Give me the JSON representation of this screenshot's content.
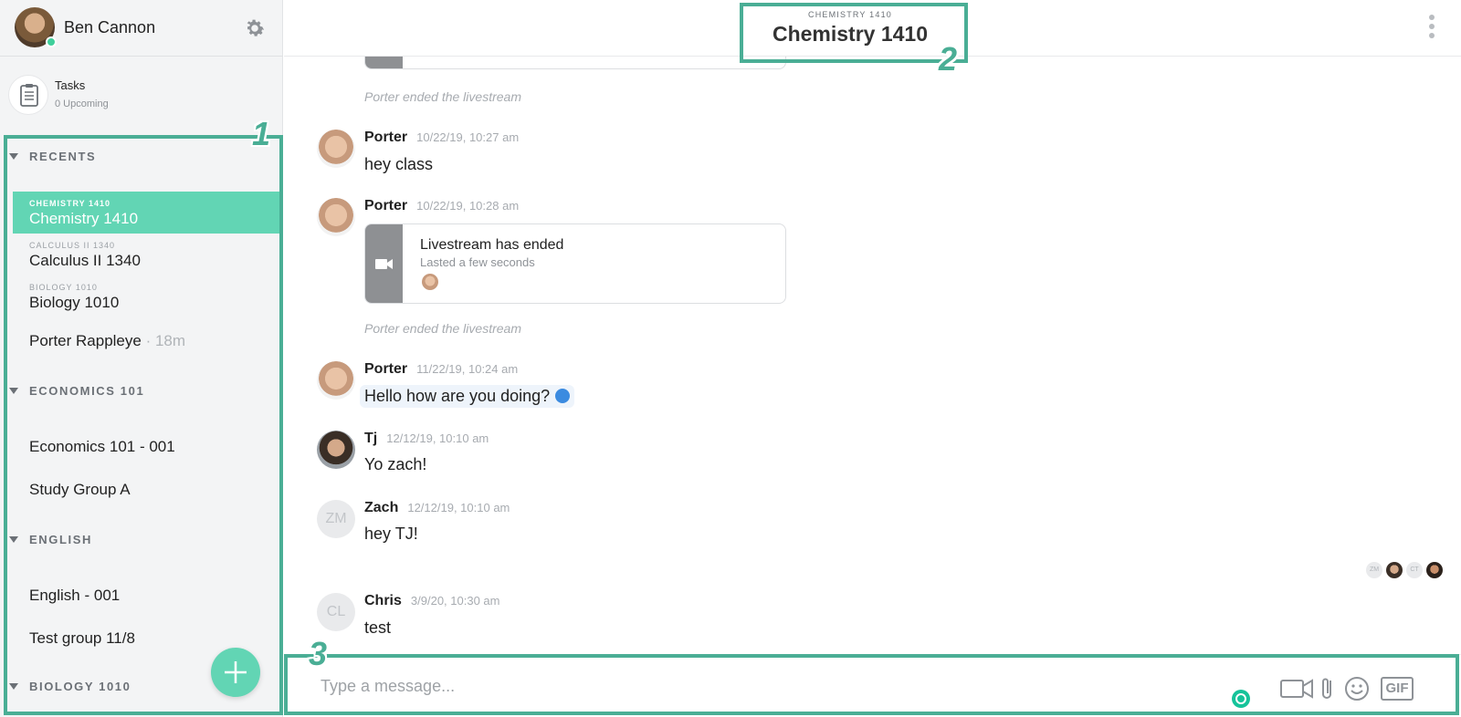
{
  "user": {
    "name": "Ben Cannon"
  },
  "tasks": {
    "title": "Tasks",
    "subtitle": "0 Upcoming"
  },
  "sidebar": {
    "sections": [
      {
        "title": "RECENTS"
      },
      {
        "title": "ECONOMICS 101"
      },
      {
        "title": "ENGLISH"
      },
      {
        "title": "BIOLOGY 1010"
      }
    ],
    "recents": [
      {
        "tiny": "CHEMISTRY 1410",
        "name": "Chemistry 1410"
      },
      {
        "tiny": "CALCULUS II 1340",
        "name": "Calculus II 1340"
      },
      {
        "tiny": "BIOLOGY 1010",
        "name": "Biology 1010"
      }
    ],
    "dm": {
      "name": "Porter Rappleye",
      "time": "· 18m"
    },
    "economics": [
      "Economics 101 - 001",
      "Study Group A"
    ],
    "english": [
      "English - 001",
      "Test group 11/8"
    ]
  },
  "header": {
    "tiny": "CHEMISTRY 1410",
    "title": "Chemistry 1410"
  },
  "feed": {
    "system1": "Porter ended the livestream",
    "system2": "Porter ended the livestream",
    "messages": [
      {
        "sender": "Porter",
        "time": "10/22/19, 10:27 am",
        "text": "hey class"
      },
      {
        "sender": "Porter",
        "time": "10/22/19, 10:28 am"
      },
      {
        "sender": "Porter",
        "time": "11/22/19, 10:24 am",
        "text": "Hello how are you doing?"
      },
      {
        "sender": "Tj",
        "time": "12/12/19, 10:10 am",
        "text": "Yo zach!"
      },
      {
        "sender": "Zach",
        "initials": "ZM",
        "time": "12/12/19, 10:10 am",
        "text": "hey TJ!"
      },
      {
        "sender": "Chris",
        "initials": "CL",
        "time": "3/9/20, 10:30 am",
        "text": "test"
      }
    ],
    "card": {
      "title": "Livestream has ended",
      "subtitle": "Lasted a few seconds"
    },
    "readers": [
      "ZM",
      "CT"
    ]
  },
  "composer": {
    "placeholder": "Type a message...",
    "gif_label": "GIF"
  },
  "annotations": [
    "1",
    "2",
    "3"
  ],
  "colors": {
    "accent": "#62d5b4",
    "annotation": "#4aae95"
  }
}
